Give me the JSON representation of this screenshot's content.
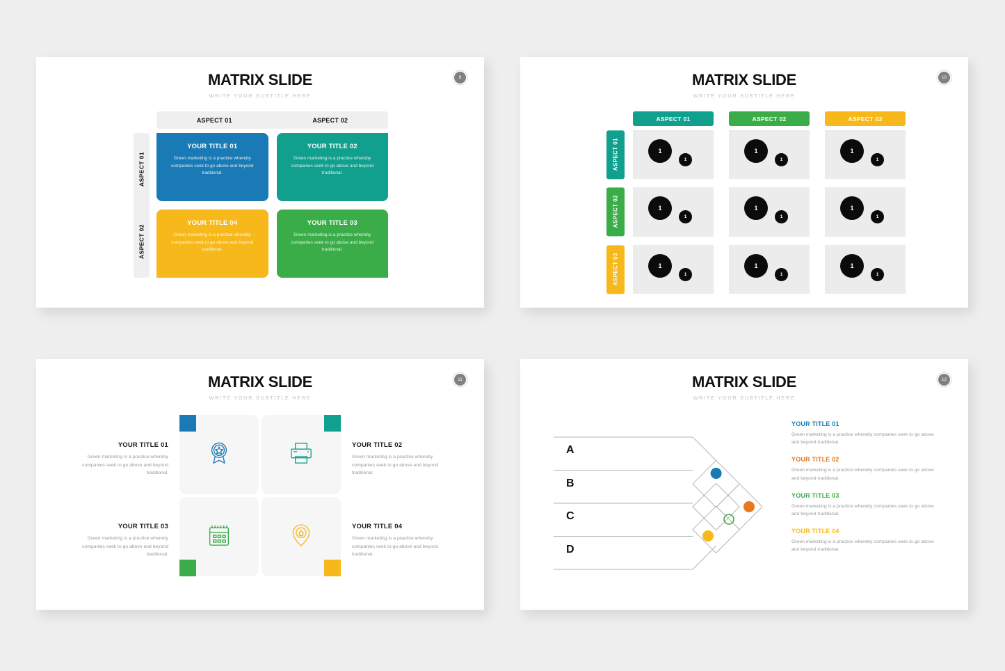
{
  "palette": {
    "blue": "#1a7ab5",
    "teal": "#10a08d",
    "green": "#3aad49",
    "yellow": "#f7b81b",
    "orange": "#e8791d",
    "dark": "#0b0b0b",
    "gray_bg": "#eeeeee",
    "cell_gray": "#ececec",
    "rail_gray": "#efefef",
    "badge_gray": "#808080",
    "body_text": "#9a9a9a"
  },
  "common": {
    "title": "MATRIX SLIDE",
    "subtitle": "WRITE YOUR SUBTITLE HERE",
    "body_text": "Green marketing is a practice whereby companies seek to go above and beyond traditional."
  },
  "slide1": {
    "page_number": "9",
    "title": "MATRIX SLIDE",
    "subtitle": "WRITE YOUR SUBTITLE HERE",
    "column_headers": [
      "ASPECT 01",
      "ASPECT 02"
    ],
    "row_headers": [
      "ASPECT 01",
      "ASPECT 02"
    ],
    "cells": [
      {
        "title": "YOUR TITLE 01",
        "body": "Green marketing is a practice whereby companies seek to go above and beyond traditional.",
        "color": "#1a7ab5"
      },
      {
        "title": "YOUR TITLE 02",
        "body": "Green marketing is a practice whereby companies seek to go above and beyond traditional.",
        "color": "#10a08d"
      },
      {
        "title": "YOUR TITLE 04",
        "body": "Green marketing is a practice whereby companies seek to go above and beyond traditional.",
        "color": "#f7b81b"
      },
      {
        "title": "YOUR TITLE 03",
        "body": "Green marketing is a practice whereby companies seek to go above and beyond traditional.",
        "color": "#3aad49"
      }
    ]
  },
  "slide2": {
    "page_number": "10",
    "title": "MATRIX SLIDE",
    "subtitle": "WRITE YOUR SUBTITLE HERE",
    "column_headers": [
      {
        "label": "ASPECT 01",
        "color": "#10a08d"
      },
      {
        "label": "ASPECT 02",
        "color": "#3aad49"
      },
      {
        "label": "ASPECT 03",
        "color": "#f7b81b"
      }
    ],
    "row_headers": [
      {
        "label": "ASPECT 01",
        "color": "#10a08d"
      },
      {
        "label": "ASPECT 02",
        "color": "#3aad49"
      },
      {
        "label": "ASPECT 03",
        "color": "#f7b81b"
      }
    ],
    "bubble_large_value": "1",
    "bubble_small_value": "1",
    "cells": [
      {
        "large": "1",
        "small": "1"
      },
      {
        "large": "1",
        "small": "1"
      },
      {
        "large": "1",
        "small": "1"
      },
      {
        "large": "1",
        "small": "1"
      },
      {
        "large": "1",
        "small": "1"
      },
      {
        "large": "1",
        "small": "1"
      },
      {
        "large": "1",
        "small": "1"
      },
      {
        "large": "1",
        "small": "1"
      },
      {
        "large": "1",
        "small": "1"
      }
    ]
  },
  "slide3": {
    "page_number": "11",
    "title": "MATRIX SLIDE",
    "subtitle": "WRITE YOUR SUBTITLE HERE",
    "items": [
      {
        "title": "YOUR TITLE 01",
        "body": "Green marketing is a practice whereby companies seek to go above and beyond traditional.",
        "color": "#1a7ab5",
        "icon": "award-badge-icon"
      },
      {
        "title": "YOUR TITLE 02",
        "body": "Green marketing is a practice whereby companies seek to go above and beyond traditional.",
        "color": "#10a08d",
        "icon": "printer-icon"
      },
      {
        "title": "YOUR TITLE 03",
        "body": "Green marketing is a practice whereby companies seek to go above and beyond traditional.",
        "color": "#3aad49",
        "icon": "calendar-icon"
      },
      {
        "title": "YOUR TITLE 04",
        "body": "Green marketing is a practice whereby companies seek to go above and beyond traditional.",
        "color": "#f7b81b",
        "icon": "location-pin-home-icon"
      }
    ]
  },
  "slide4": {
    "page_number": "12",
    "title": "MATRIX SLIDE",
    "subtitle": "WRITE YOUR SUBTITLE HERE",
    "row_labels": [
      "A",
      "B",
      "C",
      "D"
    ],
    "dots": [
      {
        "color": "#1a7ab5",
        "filled": true
      },
      {
        "color": "#e8791d",
        "filled": true
      },
      {
        "color": "#3aad49",
        "filled": false
      },
      {
        "color": "#f7b81b",
        "filled": true
      }
    ],
    "items": [
      {
        "title": "YOUR TITLE 01",
        "body": "Green marketing is a practice whereby companies seek to go above and beyond traditional.",
        "color": "#1a7ab5"
      },
      {
        "title": "YOUR TITLE 02",
        "body": "Green marketing is a practice whereby companies seek to go above and beyond traditional.",
        "color": "#e8791d"
      },
      {
        "title": "YOUR TITLE 03",
        "body": "Green marketing is a practice whereby companies seek to go above and beyond traditional.",
        "color": "#3aad49"
      },
      {
        "title": "YOUR TITLE 04",
        "body": "Green marketing is a practice whereby companies seek to go above and beyond traditional.",
        "color": "#f7b81b"
      }
    ]
  }
}
